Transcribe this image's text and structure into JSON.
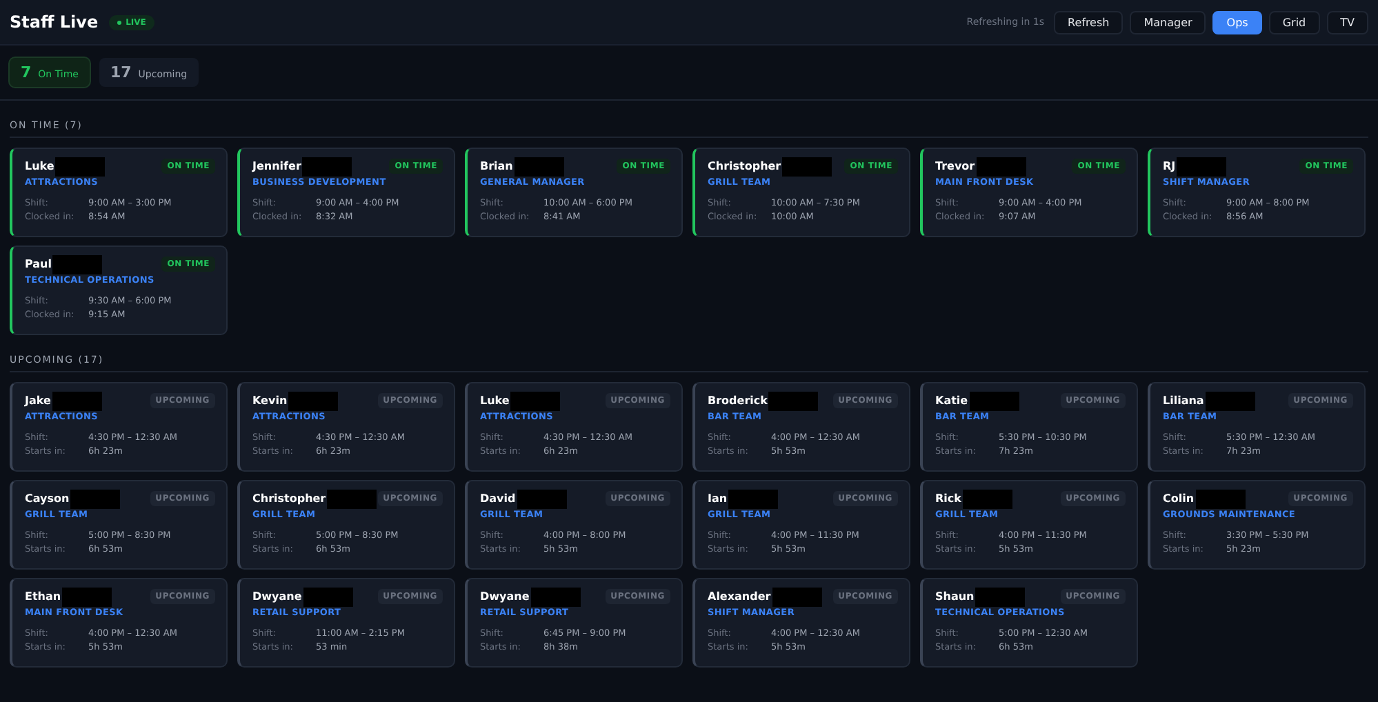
{
  "header": {
    "title": "Staff Live",
    "live_badge": "LIVE",
    "refresh_status": "Refreshing in 1s",
    "refresh_button": "Refresh",
    "views": [
      {
        "label": "Manager",
        "selected": false
      },
      {
        "label": "Ops",
        "selected": true
      },
      {
        "label": "Grid",
        "selected": false
      },
      {
        "label": "TV",
        "selected": false
      }
    ]
  },
  "stats": [
    {
      "kind": "on_time",
      "count": "7",
      "label": "On Time",
      "selected": true
    },
    {
      "kind": "upcoming",
      "count": "17",
      "label": "Upcoming",
      "selected": false
    }
  ],
  "sections": [
    {
      "kind": "on_time",
      "title": "ON TIME (7)",
      "staff": [
        {
          "name": "Luke",
          "redacted": true,
          "department": "ATTRACTIONS",
          "badge": "ON TIME",
          "shift_label": "Shift:",
          "shift": "9:00 AM – 3:00 PM",
          "detail_label": "Clocked in:",
          "detail": "8:54 AM"
        },
        {
          "name": "Jennifer",
          "redacted": true,
          "department": "BUSINESS DEVELOPMENT",
          "badge": "ON TIME",
          "shift_label": "Shift:",
          "shift": "9:00 AM – 4:00 PM",
          "detail_label": "Clocked in:",
          "detail": "8:32 AM"
        },
        {
          "name": "Brian",
          "redacted": true,
          "department": "GENERAL MANAGER",
          "badge": "ON TIME",
          "shift_label": "Shift:",
          "shift": "10:00 AM – 6:00 PM",
          "detail_label": "Clocked in:",
          "detail": "8:41 AM"
        },
        {
          "name": "Christopher",
          "redacted": true,
          "department": "GRILL TEAM",
          "badge": "ON TIME",
          "shift_label": "Shift:",
          "shift": "10:00 AM – 7:30 PM",
          "detail_label": "Clocked in:",
          "detail": "10:00 AM"
        },
        {
          "name": "Trevor",
          "redacted": true,
          "department": "MAIN FRONT DESK",
          "badge": "ON TIME",
          "shift_label": "Shift:",
          "shift": "9:00 AM – 4:00 PM",
          "detail_label": "Clocked in:",
          "detail": "9:07 AM"
        },
        {
          "name": "RJ",
          "redacted": true,
          "department": "SHIFT MANAGER",
          "badge": "ON TIME",
          "shift_label": "Shift:",
          "shift": "9:00 AM – 8:00 PM",
          "detail_label": "Clocked in:",
          "detail": "8:56 AM"
        },
        {
          "name": "Paul",
          "redacted": true,
          "department": "TECHNICAL OPERATIONS",
          "badge": "ON TIME",
          "shift_label": "Shift:",
          "shift": "9:30 AM – 6:00 PM",
          "detail_label": "Clocked in:",
          "detail": "9:15 AM"
        }
      ]
    },
    {
      "kind": "upcoming",
      "title": "UPCOMING (17)",
      "staff": [
        {
          "name": "Jake",
          "redacted": true,
          "department": "ATTRACTIONS",
          "badge": "UPCOMING",
          "shift_label": "Shift:",
          "shift": "4:30 PM – 12:30 AM",
          "detail_label": "Starts in:",
          "detail": "6h 23m"
        },
        {
          "name": "Kevin",
          "redacted": true,
          "department": "ATTRACTIONS",
          "badge": "UPCOMING",
          "shift_label": "Shift:",
          "shift": "4:30 PM – 12:30 AM",
          "detail_label": "Starts in:",
          "detail": "6h 23m"
        },
        {
          "name": "Luke",
          "redacted": true,
          "department": "ATTRACTIONS",
          "badge": "UPCOMING",
          "shift_label": "Shift:",
          "shift": "4:30 PM – 12:30 AM",
          "detail_label": "Starts in:",
          "detail": "6h 23m"
        },
        {
          "name": "Broderick",
          "redacted": true,
          "department": "BAR TEAM",
          "badge": "UPCOMING",
          "shift_label": "Shift:",
          "shift": "4:00 PM – 12:30 AM",
          "detail_label": "Starts in:",
          "detail": "5h 53m"
        },
        {
          "name": "Katie",
          "redacted": true,
          "department": "BAR TEAM",
          "badge": "UPCOMING",
          "shift_label": "Shift:",
          "shift": "5:30 PM – 10:30 PM",
          "detail_label": "Starts in:",
          "detail": "7h 23m"
        },
        {
          "name": "Liliana",
          "redacted": true,
          "department": "BAR TEAM",
          "badge": "UPCOMING",
          "shift_label": "Shift:",
          "shift": "5:30 PM – 12:30 AM",
          "detail_label": "Starts in:",
          "detail": "7h 23m"
        },
        {
          "name": "Cayson",
          "redacted": true,
          "department": "GRILL TEAM",
          "badge": "UPCOMING",
          "shift_label": "Shift:",
          "shift": "5:00 PM – 8:30 PM",
          "detail_label": "Starts in:",
          "detail": "6h 53m"
        },
        {
          "name": "Christopher",
          "redacted": true,
          "department": "GRILL TEAM",
          "badge": "UPCOMING",
          "shift_label": "Shift:",
          "shift": "5:00 PM – 8:30 PM",
          "detail_label": "Starts in:",
          "detail": "6h 53m"
        },
        {
          "name": "David",
          "redacted": true,
          "department": "GRILL TEAM",
          "badge": "UPCOMING",
          "shift_label": "Shift:",
          "shift": "4:00 PM – 8:00 PM",
          "detail_label": "Starts in:",
          "detail": "5h 53m"
        },
        {
          "name": "Ian",
          "redacted": true,
          "department": "GRILL TEAM",
          "badge": "UPCOMING",
          "shift_label": "Shift:",
          "shift": "4:00 PM – 11:30 PM",
          "detail_label": "Starts in:",
          "detail": "5h 53m"
        },
        {
          "name": "Rick",
          "redacted": true,
          "department": "GRILL TEAM",
          "badge": "UPCOMING",
          "shift_label": "Shift:",
          "shift": "4:00 PM – 11:30 PM",
          "detail_label": "Starts in:",
          "detail": "5h 53m"
        },
        {
          "name": "Colin",
          "redacted": true,
          "department": "GROUNDS MAINTENANCE",
          "badge": "UPCOMING",
          "shift_label": "Shift:",
          "shift": "3:30 PM – 5:30 PM",
          "detail_label": "Starts in:",
          "detail": "5h 23m"
        },
        {
          "name": "Ethan",
          "redacted": true,
          "department": "MAIN FRONT DESK",
          "badge": "UPCOMING",
          "shift_label": "Shift:",
          "shift": "4:00 PM – 12:30 AM",
          "detail_label": "Starts in:",
          "detail": "5h 53m"
        },
        {
          "name": "Dwyane",
          "redacted": true,
          "department": "RETAIL SUPPORT",
          "badge": "UPCOMING",
          "shift_label": "Shift:",
          "shift": "11:00 AM – 2:15 PM",
          "detail_label": "Starts in:",
          "detail": "53 min"
        },
        {
          "name": "Dwyane",
          "redacted": true,
          "department": "RETAIL SUPPORT",
          "badge": "UPCOMING",
          "shift_label": "Shift:",
          "shift": "6:45 PM – 9:00 PM",
          "detail_label": "Starts in:",
          "detail": "8h 38m"
        },
        {
          "name": "Alexander",
          "redacted": true,
          "department": "SHIFT MANAGER",
          "badge": "UPCOMING",
          "shift_label": "Shift:",
          "shift": "4:00 PM – 12:30 AM",
          "detail_label": "Starts in:",
          "detail": "5h 53m"
        },
        {
          "name": "Shaun",
          "redacted": true,
          "department": "TECHNICAL OPERATIONS",
          "badge": "UPCOMING",
          "shift_label": "Shift:",
          "shift": "5:00 PM – 12:30 AM",
          "detail_label": "Starts in:",
          "detail": "6h 53m"
        }
      ]
    }
  ]
}
